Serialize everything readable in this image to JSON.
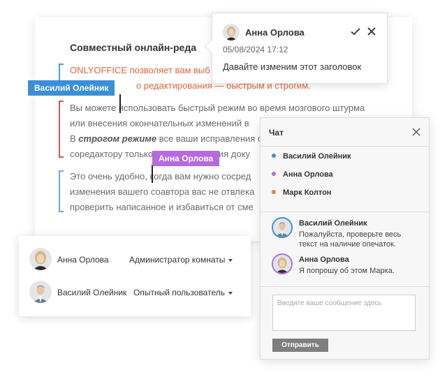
{
  "document": {
    "title": "Совместный онлайн-реда",
    "para1": [
      "ONLYOFFICE позволяет вам выб",
      "о редактирования — быстрым и строгим."
    ],
    "para2": [
      "Вы можете использовать быстрый режим во время мозгового штурма",
      "или внесения окончательных изменений в",
      "соредактору только после изменения доку"
    ],
    "para2_line3": {
      "before": "В ",
      "strict": "строгом режиме",
      "after": " все ваши исправления с"
    },
    "para3": [
      "Это очень удобно, когда вам нужно сосред",
      "изменения вашего соавтора вас не отвлека",
      "проверить написанное и избавиться от сме"
    ]
  },
  "cursors": {
    "vasily": {
      "label": "Василий Олейник",
      "color": "#3a8fd6"
    },
    "anna": {
      "label": "Анна Орлова",
      "color": "#b46be0"
    }
  },
  "comment": {
    "author": "Анна Орлова",
    "date": "05/08/2024 17:12",
    "text": "Давайте изменим этот заголовок",
    "icons": [
      "check-icon",
      "close-icon"
    ]
  },
  "users": [
    {
      "name": "Анна Орлова",
      "role": "Администратор комнаты"
    },
    {
      "name": "Василий Олейник",
      "role": "Опытный пользователь"
    }
  ],
  "chat": {
    "title": "Чат",
    "members": [
      {
        "name": "Василий Олейник",
        "color": "#3a8fd6"
      },
      {
        "name": "Анна Орлова",
        "color": "#b46be0"
      },
      {
        "name": "Марк Колтон",
        "color": "#f07e3a"
      }
    ],
    "messages": [
      {
        "author": "Василий Олейник",
        "lines": [
          "Пожалуйста, проверьте весь",
          "текст на наличие опечаток."
        ]
      },
      {
        "author": "Анна Орлова",
        "lines": [
          "Я попрошу об этом Марка."
        ]
      }
    ],
    "input_placeholder": "Введите ваше сообщение здесь",
    "send_label": "Отправить"
  }
}
